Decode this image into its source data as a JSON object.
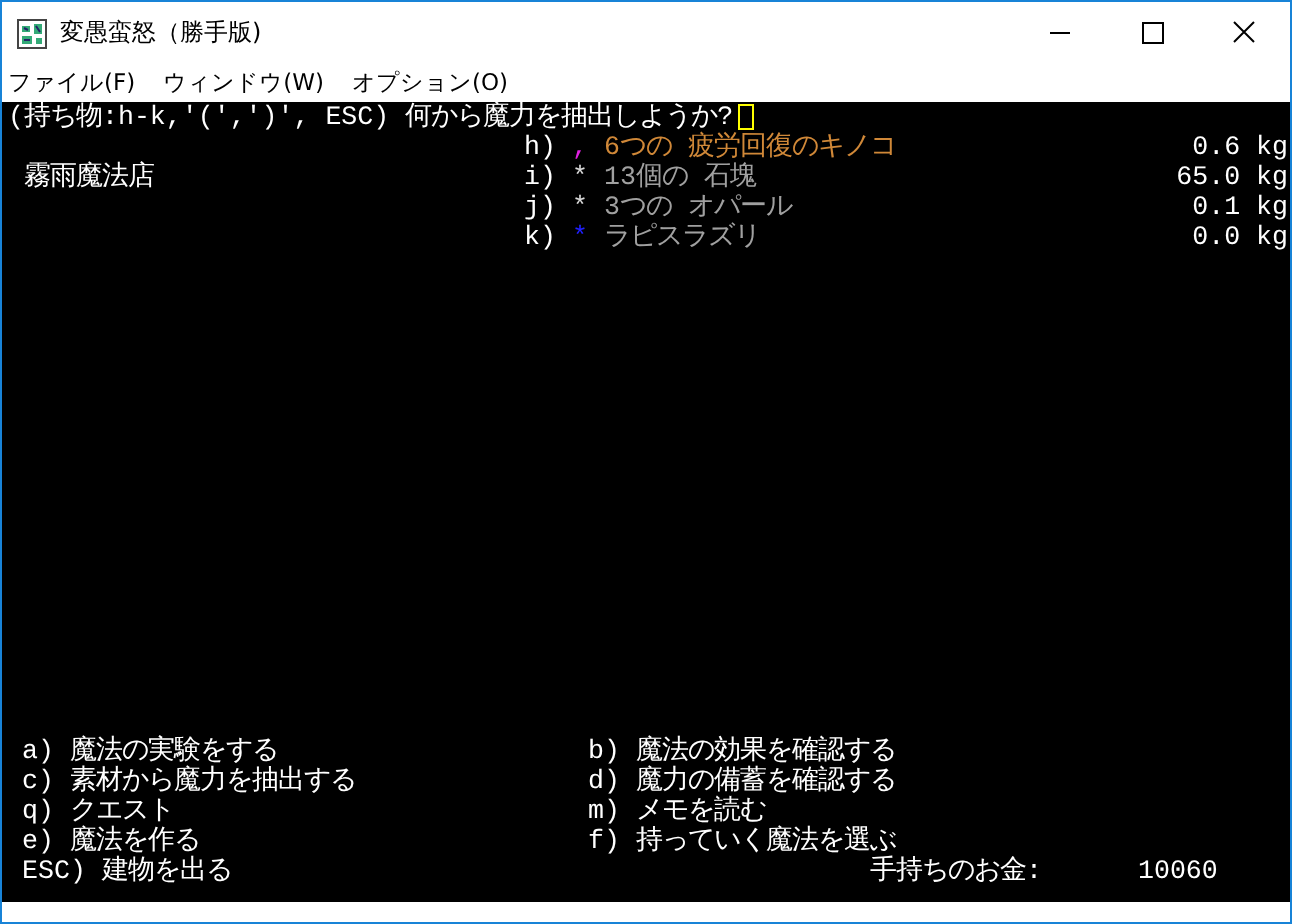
{
  "window": {
    "title": "変愚蛮怒（勝手版)"
  },
  "menu_bar": [
    "ファイル(F)",
    "ウィンドウ(W)",
    "オプション(O)"
  ],
  "prompt": "(持ち物:h-k,'(',')', ESC) 何から魔力を抽出しようか?",
  "shop_name": "霧雨魔法店",
  "items": [
    {
      "key": "h)",
      "symbol": {
        "text": ",",
        "color": "#e020e0"
      },
      "name": {
        "text": "6つの 疲労回復のキノコ",
        "color": "#d08838"
      },
      "weight": "0.6 kg"
    },
    {
      "key": "i)",
      "symbol": {
        "text": "*",
        "color": "#d8d8d8"
      },
      "name": {
        "text": "13個の 石塊",
        "color": "#a0a0a0"
      },
      "weight": "65.0 kg"
    },
    {
      "key": "j)",
      "symbol": {
        "text": "*",
        "color": "#d8d8d8"
      },
      "name": {
        "text": "3つの オパール",
        "color": "#a0a0a0"
      },
      "weight": "0.1 kg"
    },
    {
      "key": "k)",
      "symbol": {
        "text": "*",
        "color": "#2020ff"
      },
      "name": {
        "text": "ラピスラズリ",
        "color": "#a0a0a0"
      },
      "weight": "0.0 kg"
    }
  ],
  "commands_left": [
    {
      "key": "a)",
      "label": "魔法の実験をする"
    },
    {
      "key": "c)",
      "label": "素材から魔力を抽出する"
    },
    {
      "key": "q)",
      "label": "クエスト"
    },
    {
      "key": "e)",
      "label": "魔法を作る"
    },
    {
      "key": "ESC)",
      "label": "建物を出る"
    }
  ],
  "commands_right": [
    {
      "key": "b)",
      "label": "魔法の効果を確認する"
    },
    {
      "key": "d)",
      "label": "魔力の備蓄を確認する"
    },
    {
      "key": "m)",
      "label": "メモを読む"
    },
    {
      "key": "f)",
      "label": "持っていく魔法を選ぶ"
    }
  ],
  "money": {
    "label": "手持ちのお金:",
    "value": "10060"
  }
}
